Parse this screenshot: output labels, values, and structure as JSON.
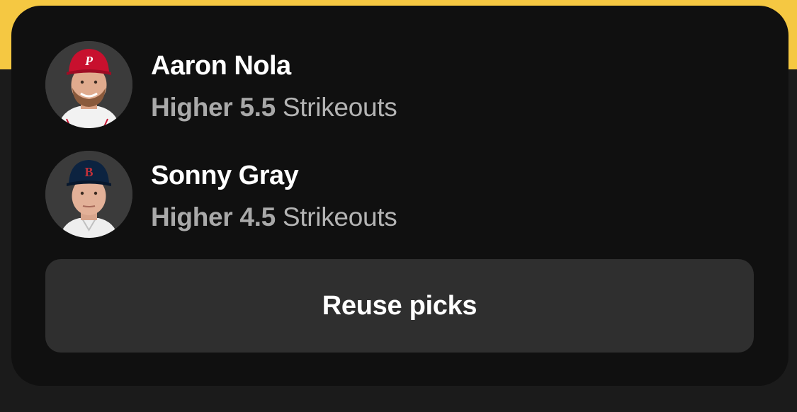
{
  "picks": [
    {
      "player_name": "Aaron Nola",
      "direction": "Higher",
      "line": "5.5",
      "stat": "Strikeouts",
      "team_logo_letter": "P",
      "cap_color": "#c8102e"
    },
    {
      "player_name": "Sonny Gray",
      "direction": "Higher",
      "line": "4.5",
      "stat": "Strikeouts",
      "team_logo_letter": "B",
      "cap_color": "#0c2340"
    }
  ],
  "reuse_button": {
    "label": "Reuse picks"
  },
  "colors": {
    "accent_yellow": "#f5c842",
    "card_bg": "#101010",
    "button_bg": "#2f2f2f"
  }
}
